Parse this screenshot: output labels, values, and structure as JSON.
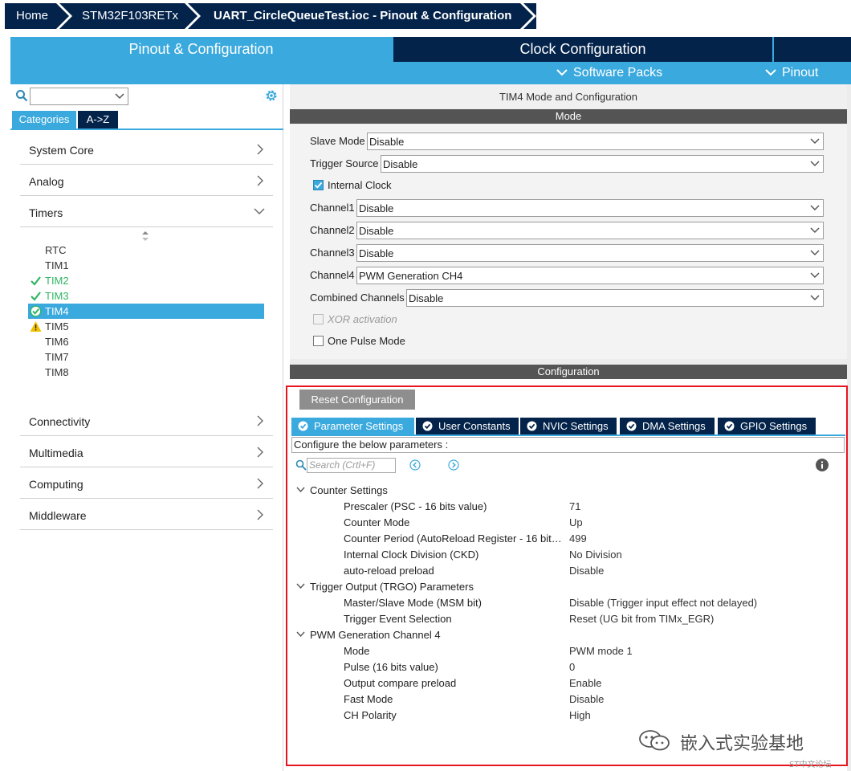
{
  "breadcrumb": {
    "home": "Home",
    "chip": "STM32F103RETx",
    "file": "UART_CircleQueueTest.ioc - Pinout & Configuration"
  },
  "top_tabs": {
    "pinout": "Pinout & Configuration",
    "clock": "Clock Configuration",
    "software_packs": "Software Packs",
    "pinout_menu": "Pinout"
  },
  "left": {
    "search_value": "",
    "tabs": {
      "categories": "Categories",
      "az": "A->Z"
    },
    "categories": [
      "System Core",
      "Analog",
      "Timers",
      "Connectivity",
      "Multimedia",
      "Computing",
      "Middleware"
    ],
    "timers": [
      {
        "name": "RTC",
        "status": "none"
      },
      {
        "name": "TIM1",
        "status": "none"
      },
      {
        "name": "TIM2",
        "status": "ok"
      },
      {
        "name": "TIM3",
        "status": "ok"
      },
      {
        "name": "TIM4",
        "status": "selected"
      },
      {
        "name": "TIM5",
        "status": "warning"
      },
      {
        "name": "TIM6",
        "status": "none"
      },
      {
        "name": "TIM7",
        "status": "none"
      },
      {
        "name": "TIM8",
        "status": "none"
      }
    ]
  },
  "mode": {
    "header": "TIM4 Mode and Configuration",
    "section_title": "Mode",
    "slave_mode": {
      "label": "Slave Mode",
      "value": "Disable"
    },
    "trigger_source": {
      "label": "Trigger Source",
      "value": "Disable"
    },
    "internal_clock": {
      "label": "Internal Clock",
      "checked": true
    },
    "channel1": {
      "label": "Channel1",
      "value": "Disable"
    },
    "channel2": {
      "label": "Channel2",
      "value": "Disable"
    },
    "channel3": {
      "label": "Channel3",
      "value": "Disable"
    },
    "channel4": {
      "label": "Channel4",
      "value": "PWM Generation CH4"
    },
    "combined": {
      "label": "Combined Channels",
      "value": "Disable"
    },
    "xor": {
      "label": "XOR activation",
      "checked": false,
      "disabled": true
    },
    "one_pulse": {
      "label": "One Pulse Mode",
      "checked": false
    }
  },
  "config": {
    "section_title": "Configuration",
    "reset_button": "Reset Configuration",
    "tabs": [
      "Parameter Settings",
      "User Constants",
      "NVIC Settings",
      "DMA Settings",
      "GPIO Settings"
    ],
    "note": "Configure the below parameters :",
    "search_placeholder": "Search (Crtl+F)",
    "groups": {
      "counter": {
        "title": "Counter Settings",
        "params": [
          {
            "name": "Prescaler (PSC - 16 bits value)",
            "value": "71"
          },
          {
            "name": "Counter Mode",
            "value": "Up"
          },
          {
            "name": "Counter Period (AutoReload Register - 16 bits value)",
            "value": "499"
          },
          {
            "name": "Internal Clock Division (CKD)",
            "value": "No Division"
          },
          {
            "name": "auto-reload preload",
            "value": "Disable"
          }
        ]
      },
      "trgo": {
        "title": "Trigger Output (TRGO) Parameters",
        "params": [
          {
            "name": "Master/Slave Mode (MSM bit)",
            "value": "Disable (Trigger input effect not delayed)"
          },
          {
            "name": "Trigger Event Selection",
            "value": "Reset (UG bit from TIMx_EGR)"
          }
        ]
      },
      "pwm": {
        "title": "PWM Generation Channel 4",
        "params": [
          {
            "name": "Mode",
            "value": "PWM mode 1"
          },
          {
            "name": "Pulse (16 bits value)",
            "value": "0"
          },
          {
            "name": "Output compare preload",
            "value": "Enable"
          },
          {
            "name": "Fast Mode",
            "value": "Disable"
          },
          {
            "name": "CH Polarity",
            "value": "High"
          }
        ]
      }
    }
  },
  "watermark": {
    "text": "嵌入式实验基地",
    "small": "ST中文论坛"
  },
  "colors": {
    "navy": "#03234b",
    "accent": "#3aa9de",
    "ok_green": "#2fb562",
    "warning": "#f2c200",
    "highlight": "#e8141e"
  },
  "icons": [
    "search-icon",
    "gear-icon",
    "chevron-right-icon",
    "chevron-down-icon",
    "check-icon",
    "warning-icon",
    "info-icon",
    "expand-icon"
  ]
}
